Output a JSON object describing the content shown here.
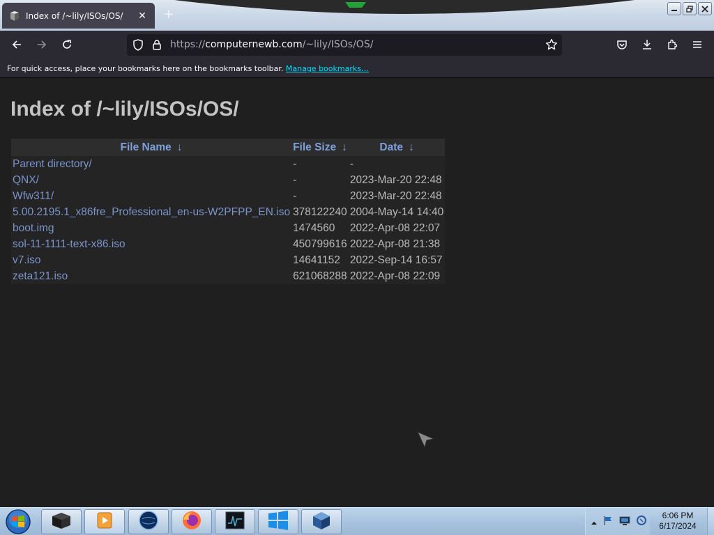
{
  "browser": {
    "tab": {
      "title": "Index of /~lily/ISOs/OS/",
      "favicon": "terminal-icon"
    },
    "url": {
      "scheme": "https://",
      "host": "computernewb.com",
      "path": "/~lily/ISOs/OS/"
    },
    "bookmarks_bar": {
      "message": "For quick access, place your bookmarks here on the bookmarks toolbar.",
      "link": "Manage bookmarks…"
    }
  },
  "page": {
    "heading": "Index of /~lily/ISOs/OS/",
    "columns": {
      "name": "File Name",
      "size": "File Size",
      "date": "Date",
      "sort_arrow": "↓"
    },
    "rows": [
      {
        "name": "Parent directory/",
        "size": "-",
        "date": "-"
      },
      {
        "name": "QNX/",
        "size": "-",
        "date": "2023-Mar-20 22:48"
      },
      {
        "name": "Wfw311/",
        "size": "-",
        "date": "2023-Mar-20 22:48"
      },
      {
        "name": "5.00.2195.1_x86fre_Professional_en-us-W2PFPP_EN.iso",
        "size": "378122240",
        "date": "2004-May-14 14:40"
      },
      {
        "name": "boot.img",
        "size": "1474560",
        "date": "2022-Apr-08 22:07"
      },
      {
        "name": "sol-11-1111-text-x86.iso",
        "size": "450799616",
        "date": "2022-Apr-08 21:38"
      },
      {
        "name": "v7.iso",
        "size": "14641152",
        "date": "2022-Sep-14 16:57"
      },
      {
        "name": "zeta121.iso",
        "size": "621068288",
        "date": "2022-Apr-08 22:09"
      }
    ]
  },
  "taskbar": {
    "clock": {
      "time": "6:06 PM",
      "date": "6/17/2024"
    },
    "apps": [
      "terminal-app-icon",
      "media-player-icon",
      "globe-browser-icon",
      "firefox-icon",
      "system-monitor-icon",
      "windows-logo-icon",
      "virtualbox-icon"
    ]
  },
  "colors": {
    "link": "#7b93c8",
    "header_link": "#7f9fdb",
    "bookmark_link": "#00ddff",
    "page_bg": "#1f1f1f"
  }
}
